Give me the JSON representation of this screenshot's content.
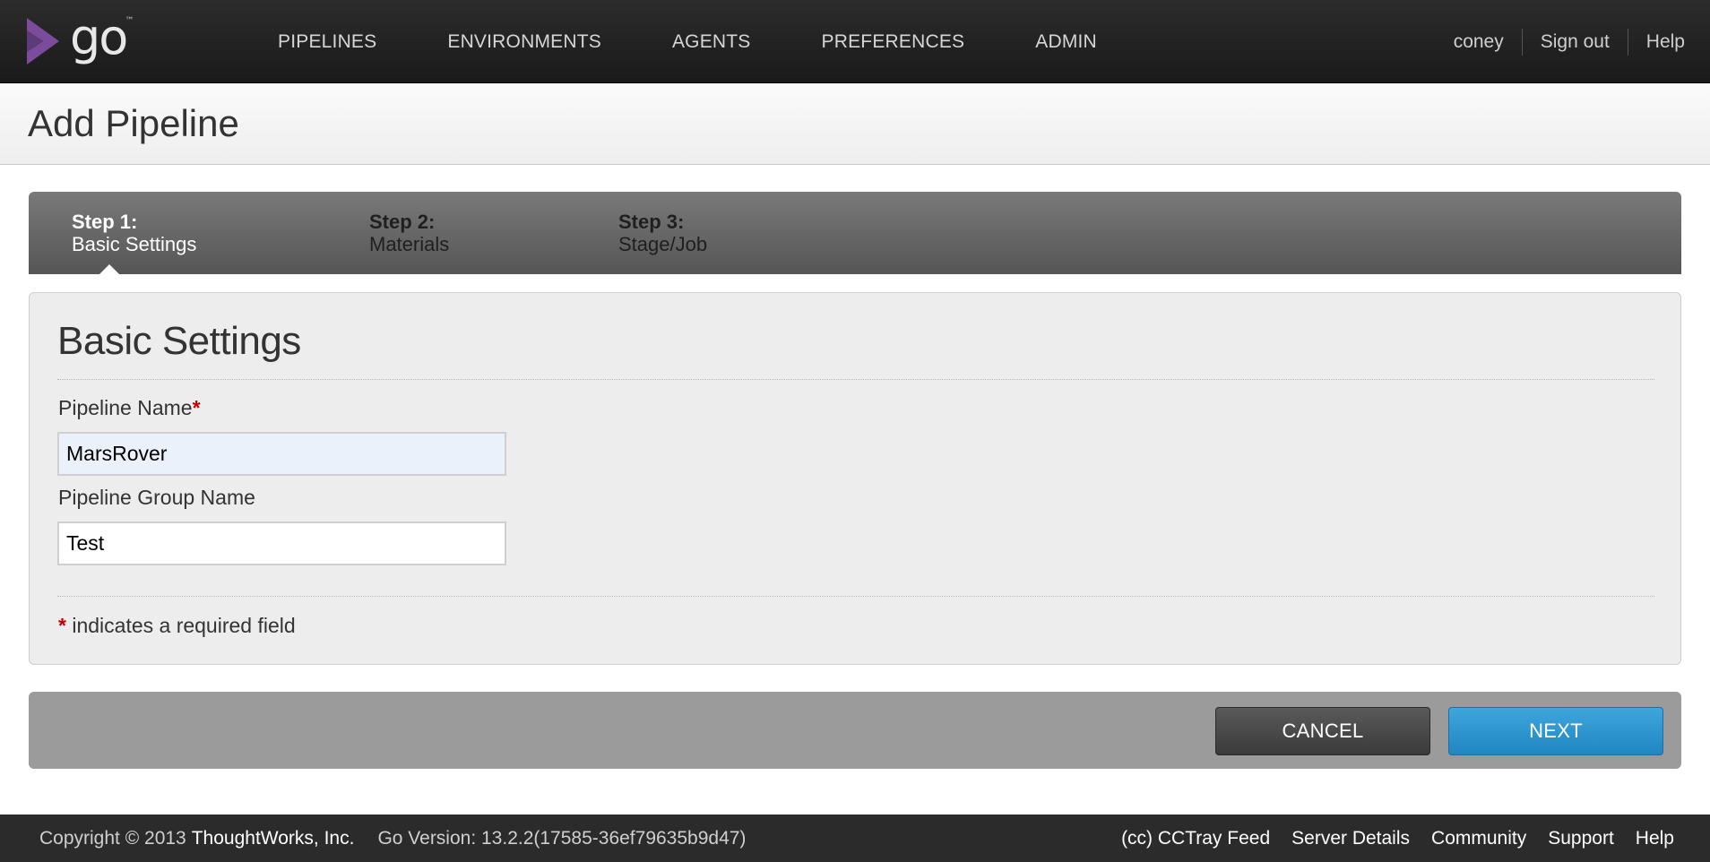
{
  "brand": {
    "logo_text": "go",
    "trademark": "™"
  },
  "nav": {
    "items": [
      "PIPELINES",
      "ENVIRONMENTS",
      "AGENTS",
      "PREFERENCES",
      "ADMIN"
    ]
  },
  "user_nav": {
    "username": "coney",
    "sign_out": "Sign out",
    "help": "Help"
  },
  "page": {
    "title": "Add Pipeline"
  },
  "wizard": {
    "steps": [
      {
        "num": "Step 1:",
        "label": "Basic Settings",
        "active": true
      },
      {
        "num": "Step 2:",
        "label": "Materials",
        "active": false
      },
      {
        "num": "Step 3:",
        "label": "Stage/Job",
        "active": false
      }
    ]
  },
  "form": {
    "heading": "Basic Settings",
    "pipeline_name_label": "Pipeline Name",
    "required_marker": "*",
    "pipeline_name_value": "MarsRover",
    "group_name_label": "Pipeline Group Name",
    "group_name_value": "Test",
    "required_note": "indicates a required field"
  },
  "actions": {
    "cancel": "CANCEL",
    "next": "NEXT"
  },
  "footer": {
    "copyright": "Copyright © 2013",
    "company": "ThoughtWorks, Inc.",
    "version": "Go Version: 13.2.2(17585-36ef79635b9d47)",
    "links": [
      "(cc) CCTray Feed",
      "Server Details",
      "Community",
      "Support",
      "Help"
    ]
  },
  "colors": {
    "header_bg": "#1f1f1f",
    "logo_purple": "#7b4c9b",
    "next_button": "#2a94cf",
    "cancel_button": "#474747",
    "required": "#c00000"
  }
}
